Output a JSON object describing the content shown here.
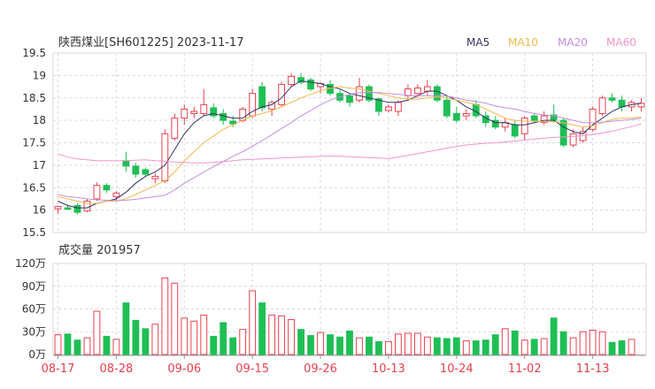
{
  "header": {
    "title": "陕西煤业[SH601225] 2023-11-17",
    "ma_legend": [
      {
        "label": "MA5",
        "color": "#333366"
      },
      {
        "label": "MA10",
        "color": "#f2b84b"
      },
      {
        "label": "MA20",
        "color": "#c58de0"
      },
      {
        "label": "MA60",
        "color": "#f295c8"
      }
    ]
  },
  "volume_title": "成交量 201957",
  "colors": {
    "up": "#e8424f",
    "down": "#1fbf55",
    "grid": "#d9d9d9",
    "axis": "#999999",
    "date_label": "#e8424f"
  },
  "chart_data": [
    {
      "type": "candlestick",
      "title": "陕西煤业[SH601225] 2023-11-17",
      "ylim": [
        15.5,
        19.5
      ],
      "yticks": [
        15.5,
        16,
        16.5,
        17,
        17.5,
        18,
        18.5,
        19,
        19.5
      ],
      "x_tick_labels": [
        {
          "index": 0,
          "label": "08-17"
        },
        {
          "index": 6,
          "label": "08-28"
        },
        {
          "index": 13,
          "label": "09-06"
        },
        {
          "index": 20,
          "label": "09-15"
        },
        {
          "index": 27,
          "label": "09-26"
        },
        {
          "index": 34,
          "label": "10-13"
        },
        {
          "index": 41,
          "label": "10-24"
        },
        {
          "index": 48,
          "label": "11-02"
        },
        {
          "index": 55,
          "label": "11-13"
        }
      ],
      "ohlc": [
        [
          16.03,
          16.1,
          15.92,
          16.08
        ],
        [
          16.05,
          16.12,
          16.0,
          16.02
        ],
        [
          16.1,
          16.15,
          15.9,
          15.95
        ],
        [
          15.98,
          16.25,
          15.95,
          16.2
        ],
        [
          16.25,
          16.62,
          16.2,
          16.55
        ],
        [
          16.55,
          16.6,
          16.38,
          16.45
        ],
        [
          16.3,
          16.42,
          16.2,
          16.38
        ],
        [
          17.1,
          17.3,
          16.85,
          16.98
        ],
        [
          16.98,
          17.05,
          16.72,
          16.8
        ],
        [
          16.9,
          16.95,
          16.75,
          16.8
        ],
        [
          16.7,
          16.82,
          16.6,
          16.75
        ],
        [
          16.65,
          17.8,
          16.6,
          17.7
        ],
        [
          17.6,
          18.15,
          17.55,
          18.05
        ],
        [
          18.05,
          18.35,
          17.9,
          18.25
        ],
        [
          18.15,
          18.3,
          18.05,
          18.2
        ],
        [
          18.15,
          18.7,
          18.1,
          18.35
        ],
        [
          18.28,
          18.38,
          18.05,
          18.1
        ],
        [
          18.15,
          18.25,
          17.9,
          18.0
        ],
        [
          17.98,
          18.1,
          17.85,
          17.92
        ],
        [
          18.0,
          18.3,
          17.95,
          18.25
        ],
        [
          18.1,
          18.7,
          18.05,
          18.6
        ],
        [
          18.75,
          18.85,
          18.2,
          18.28
        ],
        [
          18.25,
          18.45,
          18.1,
          18.4
        ],
        [
          18.35,
          18.85,
          18.3,
          18.8
        ],
        [
          18.8,
          19.05,
          18.75,
          18.98
        ],
        [
          18.95,
          19.05,
          18.8,
          18.85
        ],
        [
          18.9,
          18.95,
          18.65,
          18.7
        ],
        [
          18.75,
          18.85,
          18.6,
          18.82
        ],
        [
          18.8,
          18.9,
          18.55,
          18.6
        ],
        [
          18.6,
          18.68,
          18.4,
          18.45
        ],
        [
          18.55,
          18.6,
          18.3,
          18.4
        ],
        [
          18.45,
          18.95,
          18.4,
          18.75
        ],
        [
          18.75,
          18.8,
          18.4,
          18.45
        ],
        [
          18.48,
          18.5,
          18.1,
          18.2
        ],
        [
          18.22,
          18.35,
          18.18,
          18.3
        ],
        [
          18.2,
          18.45,
          18.1,
          18.4
        ],
        [
          18.55,
          18.8,
          18.45,
          18.7
        ],
        [
          18.6,
          18.8,
          18.5,
          18.72
        ],
        [
          18.65,
          18.9,
          18.55,
          18.75
        ],
        [
          18.75,
          18.8,
          18.4,
          18.45
        ],
        [
          18.45,
          18.55,
          18.05,
          18.1
        ],
        [
          18.15,
          18.3,
          17.95,
          18.0
        ],
        [
          18.1,
          18.25,
          18.0,
          18.15
        ],
        [
          18.35,
          18.45,
          18.05,
          18.1
        ],
        [
          18.1,
          18.2,
          17.85,
          17.95
        ],
        [
          18.0,
          18.1,
          17.8,
          17.85
        ],
        [
          17.85,
          18.05,
          17.75,
          17.95
        ],
        [
          17.9,
          18.0,
          17.6,
          17.65
        ],
        [
          17.7,
          18.1,
          17.55,
          18.05
        ],
        [
          18.1,
          18.15,
          17.95,
          18.0
        ],
        [
          17.95,
          18.2,
          17.9,
          18.1
        ],
        [
          18.12,
          18.35,
          17.95,
          18.0
        ],
        [
          18.0,
          18.05,
          17.4,
          17.45
        ],
        [
          17.45,
          17.8,
          17.4,
          17.7
        ],
        [
          17.55,
          17.85,
          17.5,
          17.75
        ],
        [
          17.8,
          18.3,
          17.75,
          18.25
        ],
        [
          18.15,
          18.55,
          18.1,
          18.5
        ],
        [
          18.5,
          18.6,
          18.4,
          18.45
        ],
        [
          18.45,
          18.55,
          18.2,
          18.3
        ],
        [
          18.3,
          18.45,
          18.2,
          18.4
        ],
        [
          18.3,
          18.5,
          18.2,
          18.38
        ]
      ],
      "ma": {
        "MA5": [
          16.2,
          16.1,
          16.05,
          16.05,
          16.15,
          16.2,
          16.25,
          16.4,
          16.6,
          16.75,
          16.85,
          17.0,
          17.35,
          17.7,
          17.95,
          18.1,
          18.15,
          18.1,
          18.05,
          18.05,
          18.2,
          18.3,
          18.35,
          18.5,
          18.75,
          18.88,
          18.85,
          18.82,
          18.75,
          18.7,
          18.6,
          18.55,
          18.5,
          18.45,
          18.4,
          18.4,
          18.45,
          18.55,
          18.65,
          18.65,
          18.55,
          18.45,
          18.3,
          18.2,
          18.05,
          17.95,
          17.95,
          17.9,
          17.9,
          17.95,
          18.0,
          18.0,
          17.85,
          17.75,
          17.7,
          17.9,
          18.05,
          18.2,
          18.3,
          18.35,
          18.38
        ],
        "MA10": [
          16.3,
          16.25,
          16.2,
          16.15,
          16.15,
          16.2,
          16.2,
          16.25,
          16.35,
          16.45,
          16.55,
          16.65,
          16.85,
          17.1,
          17.3,
          17.5,
          17.65,
          17.8,
          17.9,
          18.0,
          18.1,
          18.15,
          18.22,
          18.3,
          18.4,
          18.5,
          18.58,
          18.66,
          18.72,
          18.75,
          18.72,
          18.7,
          18.65,
          18.6,
          18.55,
          18.5,
          18.47,
          18.47,
          18.5,
          18.52,
          18.5,
          18.45,
          18.4,
          18.35,
          18.25,
          18.15,
          18.05,
          18.0,
          17.98,
          17.98,
          17.97,
          17.97,
          17.95,
          17.9,
          17.85,
          17.88,
          17.95,
          18.02,
          18.05,
          18.05,
          18.08
        ],
        "MA20": [
          16.35,
          16.3,
          16.28,
          16.25,
          16.23,
          16.22,
          16.21,
          16.22,
          16.24,
          16.27,
          16.3,
          16.33,
          16.45,
          16.6,
          16.72,
          16.85,
          16.97,
          17.08,
          17.2,
          17.3,
          17.42,
          17.55,
          17.68,
          17.82,
          17.95,
          18.1,
          18.22,
          18.35,
          18.45,
          18.52,
          18.58,
          18.62,
          18.63,
          18.62,
          18.6,
          18.58,
          18.56,
          18.55,
          18.55,
          18.55,
          18.54,
          18.5,
          18.45,
          18.42,
          18.38,
          18.32,
          18.28,
          18.25,
          18.2,
          18.15,
          18.12,
          18.1,
          18.05,
          18.0,
          17.95,
          17.95,
          17.96,
          17.98,
          18.0,
          18.02,
          18.05
        ],
        "MA60": [
          17.25,
          17.18,
          17.14,
          17.12,
          17.1,
          17.1,
          17.1,
          17.1,
          17.11,
          17.12,
          17.1,
          17.09,
          17.07,
          17.06,
          17.05,
          17.05,
          17.06,
          17.08,
          17.1,
          17.12,
          17.13,
          17.14,
          17.15,
          17.16,
          17.17,
          17.18,
          17.19,
          17.2,
          17.2,
          17.2,
          17.19,
          17.18,
          17.17,
          17.16,
          17.15,
          17.18,
          17.22,
          17.26,
          17.3,
          17.34,
          17.38,
          17.42,
          17.45,
          17.47,
          17.49,
          17.5,
          17.52,
          17.54,
          17.56,
          17.58,
          17.6,
          17.62,
          17.63,
          17.64,
          17.66,
          17.68,
          17.72,
          17.76,
          17.81,
          17.86,
          17.92
        ]
      }
    },
    {
      "type": "bar",
      "title": "成交量 201957",
      "ylim": [
        0,
        120
      ],
      "yticks": [
        {
          "value": 0,
          "label": "0万"
        },
        {
          "value": 30,
          "label": "30万"
        },
        {
          "value": 60,
          "label": "60万"
        },
        {
          "value": 90,
          "label": "90万"
        },
        {
          "value": 120,
          "label": "120万"
        }
      ],
      "values": [
        26,
        27,
        19,
        22,
        57,
        24,
        20,
        68,
        45,
        34,
        40,
        101,
        94,
        48,
        44,
        52,
        24,
        42,
        22,
        33,
        84,
        68,
        52,
        51,
        46,
        33,
        25,
        29,
        26,
        23,
        31,
        22,
        23,
        17,
        17,
        27,
        28,
        28,
        23,
        22,
        21,
        22,
        18,
        18,
        19,
        26,
        34,
        31,
        19,
        20,
        21,
        48,
        30,
        22,
        30,
        32,
        30,
        16,
        18,
        20
      ]
    }
  ]
}
